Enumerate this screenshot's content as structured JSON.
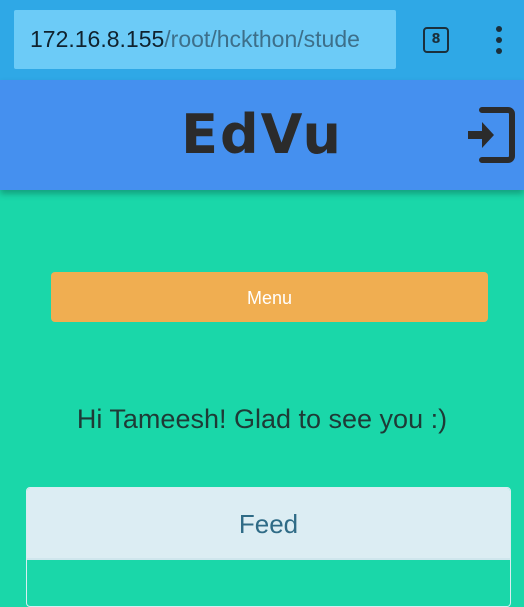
{
  "browser": {
    "url_host": "172.16.8.155",
    "url_path": "/root/hckthon/stude",
    "tab_count": "8",
    "more_icon": "more-vert-icon"
  },
  "header": {
    "brand": "EdVu",
    "login_icon": "login-icon"
  },
  "main": {
    "menu_label": "Menu",
    "greeting": "Hi Tameesh! Glad to see you :)",
    "feed_title": "Feed"
  },
  "colors": {
    "browser_bar": "#2fa8e6",
    "header": "#4590ef",
    "background": "#1ad7a9",
    "menu_button": "#f0ae51",
    "feed_header": "#dcedf3"
  }
}
